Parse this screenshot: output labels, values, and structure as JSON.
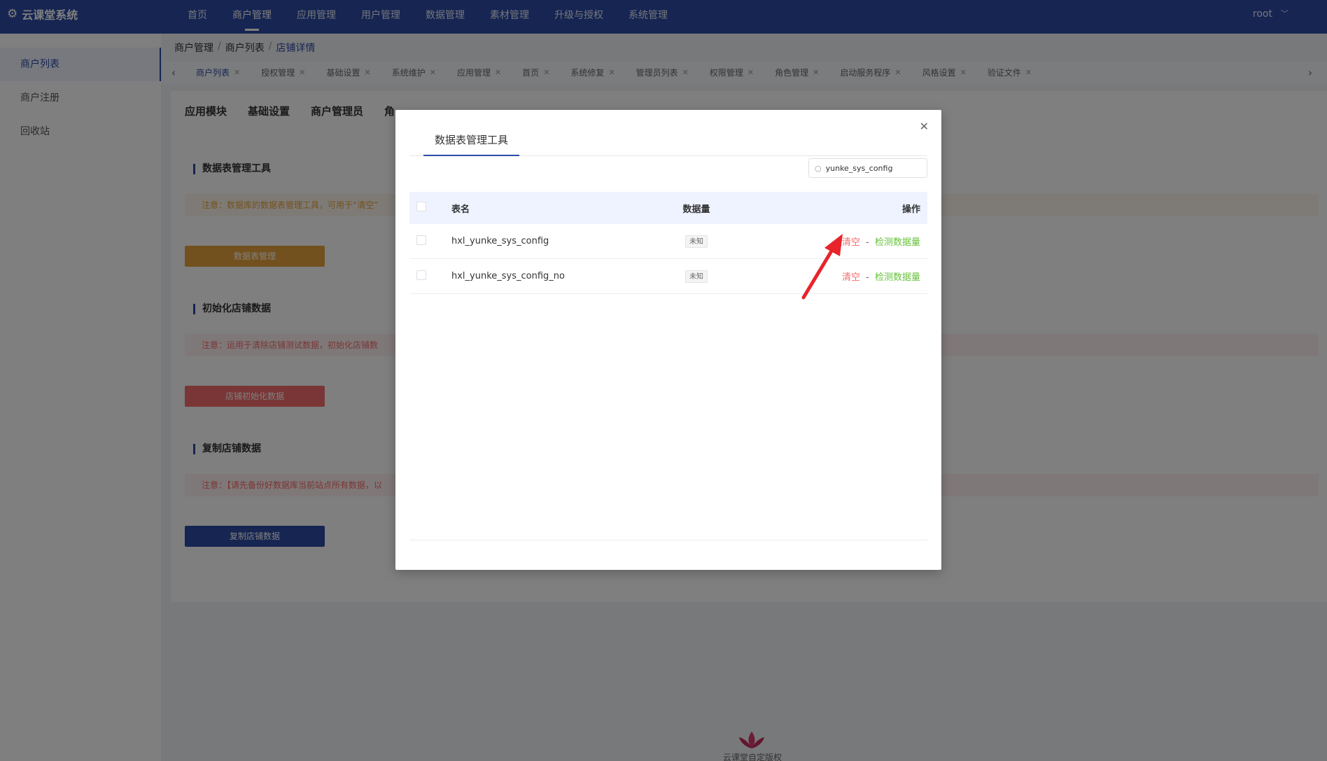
{
  "app": {
    "title": "云课堂系统",
    "logo_icon": "gear-icon"
  },
  "nav": {
    "items": [
      {
        "label": "首页"
      },
      {
        "label": "商户管理",
        "active": true
      },
      {
        "label": "应用管理"
      },
      {
        "label": "用户管理"
      },
      {
        "label": "数据管理"
      },
      {
        "label": "素材管理"
      },
      {
        "label": "升级与授权"
      },
      {
        "label": "系统管理"
      }
    ],
    "user": "root"
  },
  "sidebar": {
    "items": [
      {
        "label": "商户列表",
        "active": true
      },
      {
        "label": "商户注册"
      },
      {
        "label": "回收站"
      }
    ]
  },
  "breadcrumb": {
    "level1": "商户管理",
    "level2": "商户列表",
    "current": "店铺详情",
    "separator": "/"
  },
  "tabs": [
    {
      "label": "商户列表",
      "active": true
    },
    {
      "label": "授权管理"
    },
    {
      "label": "基础设置"
    },
    {
      "label": "系统维护"
    },
    {
      "label": "应用管理"
    },
    {
      "label": "首页"
    },
    {
      "label": "系统修复"
    },
    {
      "label": "管理员列表"
    },
    {
      "label": "权限管理"
    },
    {
      "label": "角色管理"
    },
    {
      "label": "启动服务程序"
    },
    {
      "label": "风格设置"
    },
    {
      "label": "验证文件"
    }
  ],
  "main": {
    "subtabs": [
      "应用模块",
      "基础设置",
      "商户管理员",
      "角"
    ],
    "sections": [
      {
        "title": "数据表管理工具",
        "notice": "注意：数据库的数据表管理工具，可用于“清空”",
        "button": "数据表管理"
      },
      {
        "title": "初始化店铺数据",
        "notice": "注意：运用于清除店铺测试数据，初始化店铺数",
        "button": "店铺初始化数据"
      },
      {
        "title": "复制店铺数据",
        "notice": "注意：【请先备份好数据库当前站点所有数据，以",
        "button": "复制店铺数据"
      }
    ],
    "footer": "云课堂自定版权"
  },
  "modal": {
    "tab": "数据表管理工具",
    "search_value": "yunke_sys_config",
    "columns": {
      "name": "表名",
      "count": "数据量",
      "action": "操作"
    },
    "rows": [
      {
        "name": "hxl_yunke_sys_config",
        "count": "未知",
        "clear": "清空",
        "sep": "-",
        "check": "检测数据量"
      },
      {
        "name": "hxl_yunke_sys_config_no",
        "count": "未知",
        "clear": "清空",
        "sep": "-",
        "check": "检测数据量"
      }
    ]
  },
  "colors": {
    "primary": "#2c4ba4",
    "danger": "#f56c6c",
    "success": "#67c23a",
    "warning": "#e6a23c",
    "arrow": "#e8242a"
  }
}
